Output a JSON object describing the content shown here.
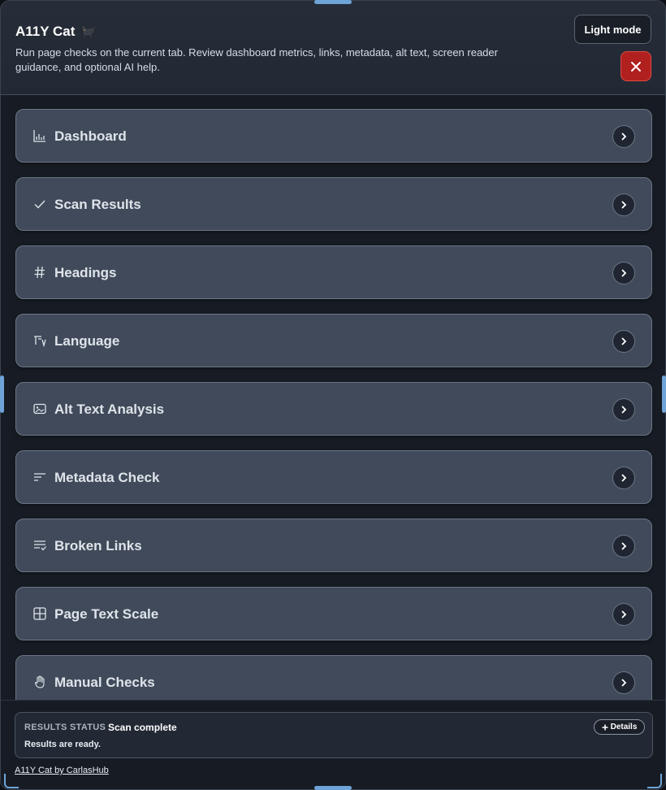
{
  "header": {
    "title": "A11Y Cat",
    "description": "Run page checks on the current tab. Review dashboard metrics, links, metadata, alt text, screen reader guidance, and optional AI help.",
    "light_mode_label": "Light mode"
  },
  "sections": [
    {
      "label": "Dashboard",
      "icon": "bar-chart-icon"
    },
    {
      "label": "Scan Results",
      "icon": "check-icon"
    },
    {
      "label": "Headings",
      "icon": "hash-icon"
    },
    {
      "label": "Language",
      "icon": "language-icon"
    },
    {
      "label": "Alt Text Analysis",
      "icon": "image-icon"
    },
    {
      "label": "Metadata Check",
      "icon": "lines-icon"
    },
    {
      "label": "Broken Links",
      "icon": "list-check-icon"
    },
    {
      "label": "Page Text Scale",
      "icon": "grid-icon"
    },
    {
      "label": "Manual Checks",
      "icon": "hand-icon"
    }
  ],
  "status": {
    "key": "RESULTS STATUS",
    "value": "Scan complete",
    "message": "Results are ready.",
    "details_label": "Details"
  },
  "footer": {
    "link": "A11Y Cat by CarlasHub"
  },
  "colors": {
    "accent": "#6fa4d8",
    "close": "#b0201f",
    "section_bg": "#404a5a",
    "background": "#171c24"
  }
}
